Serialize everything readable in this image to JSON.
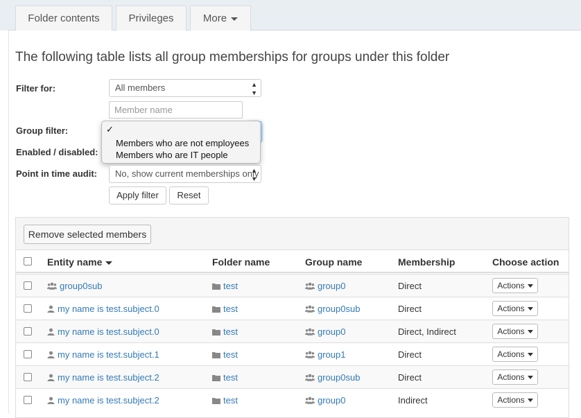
{
  "tabs": [
    {
      "label": "Folder contents"
    },
    {
      "label": "Privileges"
    },
    {
      "label": "More"
    }
  ],
  "heading": "The following table lists all group memberships for groups under this folder",
  "filters": {
    "filter_for_label": "Filter for:",
    "filter_for_value": "All members",
    "member_name_placeholder": "Member name",
    "group_filter_label": "Group filter:",
    "group_filter_checkmark": "✓",
    "group_filter_options": [
      "Members who are not employees",
      "Members who are IT people"
    ],
    "enabled_label": "Enabled / disabled:",
    "point_in_time_label": "Point in time audit:",
    "point_in_time_value": "No, show current memberships only",
    "apply_label": "Apply filter",
    "reset_label": "Reset"
  },
  "table": {
    "remove_selected_label": "Remove selected members",
    "columns": [
      "Entity name",
      "Folder name",
      "Group name",
      "Membership",
      "Choose action"
    ],
    "action_label": "Actions",
    "rows": [
      {
        "entity": "group0sub",
        "entity_type": "group",
        "folder": "test",
        "group": "group0",
        "membership": "Direct"
      },
      {
        "entity": "my name is test.subject.0",
        "entity_type": "person",
        "folder": "test",
        "group": "group0sub",
        "membership": "Direct"
      },
      {
        "entity": "my name is test.subject.0",
        "entity_type": "person",
        "folder": "test",
        "group": "group0",
        "membership": "Direct, Indirect"
      },
      {
        "entity": "my name is test.subject.1",
        "entity_type": "person",
        "folder": "test",
        "group": "group1",
        "membership": "Direct"
      },
      {
        "entity": "my name is test.subject.2",
        "entity_type": "person",
        "folder": "test",
        "group": "group0sub",
        "membership": "Direct"
      },
      {
        "entity": "my name is test.subject.2",
        "entity_type": "person",
        "folder": "test",
        "group": "group0",
        "membership": "Indirect"
      }
    ]
  },
  "colors": {
    "link": "#337ab7",
    "icon": "#888888"
  }
}
